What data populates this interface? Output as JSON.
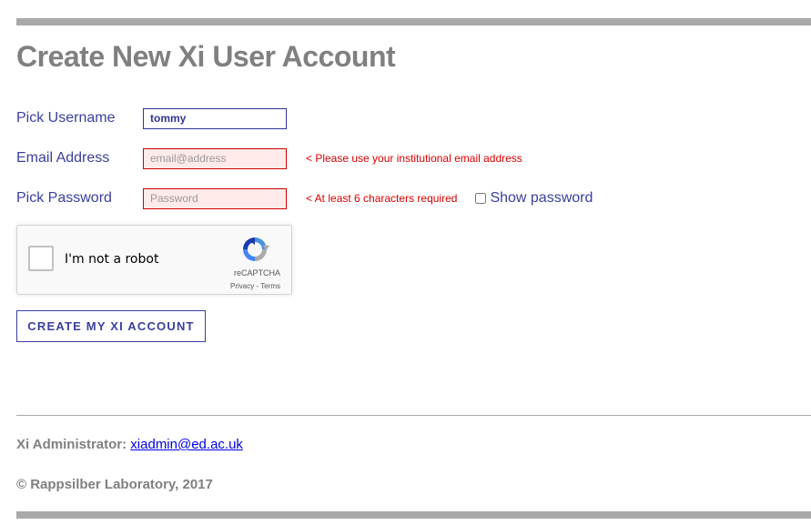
{
  "page": {
    "title": "Create New Xi User Account"
  },
  "form": {
    "username": {
      "label": "Pick Username",
      "value": "tommy"
    },
    "email": {
      "label": "Email Address",
      "placeholder": "email@address",
      "value": "",
      "error": "< Please use your institutional email address"
    },
    "password": {
      "label": "Pick Password",
      "placeholder": "Password",
      "value": "",
      "error": "< At least 6 characters required",
      "show_password_label": "Show password",
      "show_password_checked": false
    },
    "recaptcha": {
      "label": "I'm not a robot",
      "brand": "reCAPTCHA",
      "privacy_link": "Privacy",
      "separator": " - ",
      "terms_link": "Terms",
      "icon": "recaptcha-logo-icon"
    },
    "submit_label": "CREATE MY XI ACCOUNT"
  },
  "footer": {
    "admin_label": "Xi Administrator:",
    "admin_email": "xiadmin@ed.ac.uk",
    "copyright": "© Rappsilber Laboratory, 2017"
  },
  "colors": {
    "label_blue": "#3b3fa0",
    "error_red": "#dd0000",
    "title_gray": "#808080",
    "rule_gray": "#a9a9a9",
    "invalid_bg": "#ffeaea"
  }
}
